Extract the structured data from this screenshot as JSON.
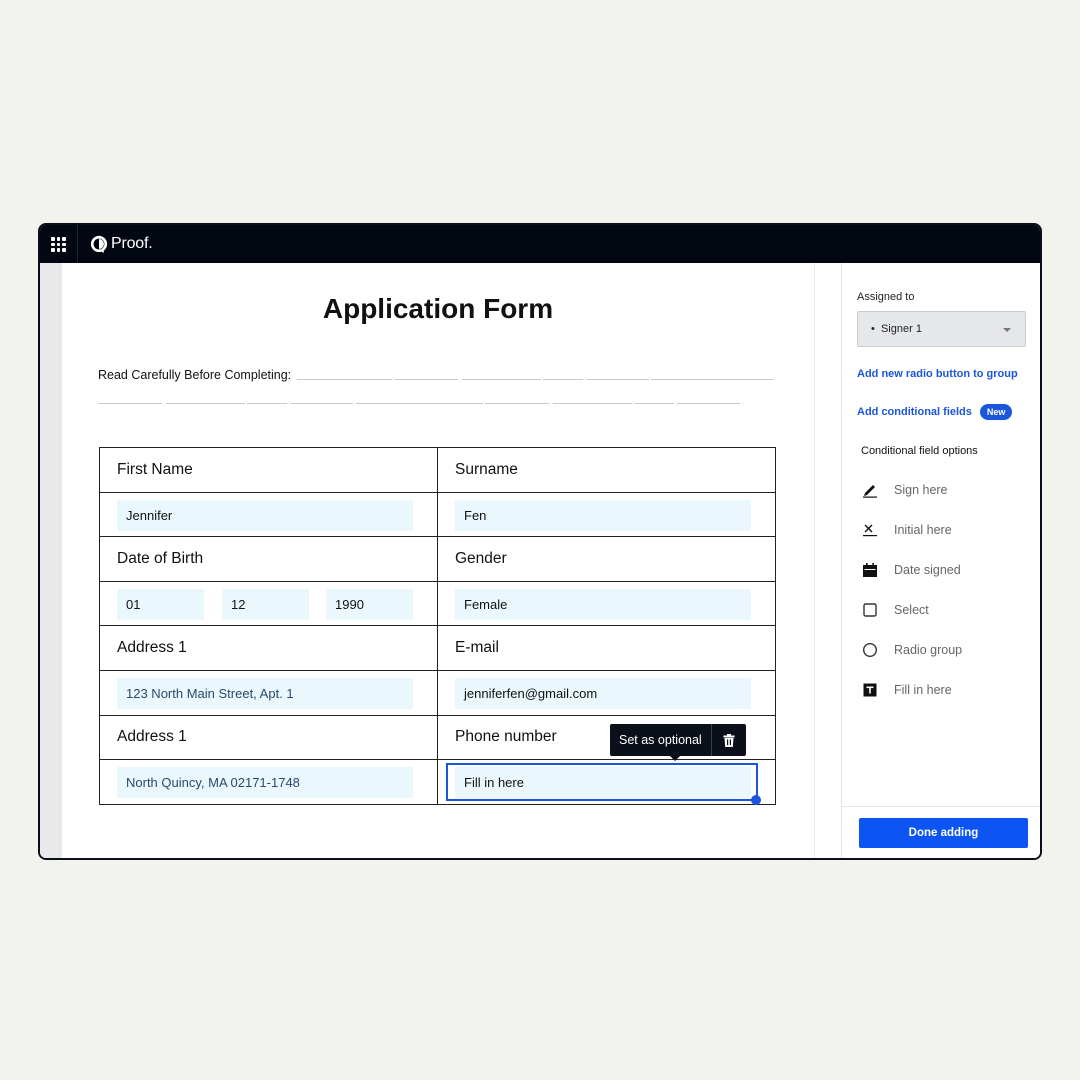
{
  "app": {
    "brand": "Proof."
  },
  "document": {
    "title": "Application Form",
    "instruction": "Read Carefully Before Completing:",
    "rows": [
      {
        "left_label": "First Name",
        "right_label": "Surname"
      },
      {
        "left_label": "Date of Birth",
        "right_label": "Gender"
      },
      {
        "left_label": "Address 1",
        "right_label": "E-mail"
      },
      {
        "left_label": "Address 1",
        "right_label": "Phone number"
      }
    ],
    "fields": {
      "first_name": "Jennifer",
      "surname": "Fen",
      "dob_day": "01",
      "dob_month": "12",
      "dob_year": "1990",
      "gender": "Female",
      "address1": "123 North Main Street, Apt. 1",
      "email": "jenniferfen@gmail.com",
      "address2": "North Quincy, MA 02171-1748",
      "phone": "Fill in here"
    },
    "tooltip": {
      "label": "Set as optional"
    }
  },
  "sidebar": {
    "assigned_label": "Assigned to",
    "assigned_value": "Signer 1",
    "add_radio_link": "Add new radio button to group",
    "add_conditional_link": "Add conditional fields",
    "new_badge": "New",
    "options_heading": "Conditional field options",
    "options": [
      {
        "label": "Sign here",
        "icon": "pen-icon"
      },
      {
        "label": "Initial here",
        "icon": "initial-x-icon"
      },
      {
        "label": "Date signed",
        "icon": "calendar-icon"
      },
      {
        "label": "Select",
        "icon": "checkbox-icon"
      },
      {
        "label": "Radio group",
        "icon": "radio-icon"
      },
      {
        "label": "Fill in here",
        "icon": "text-field-icon"
      }
    ],
    "done_button": "Done adding"
  },
  "colors": {
    "accent": "#0c55f2",
    "topbar": "#030712",
    "field_bg": "#eaf8fd"
  }
}
